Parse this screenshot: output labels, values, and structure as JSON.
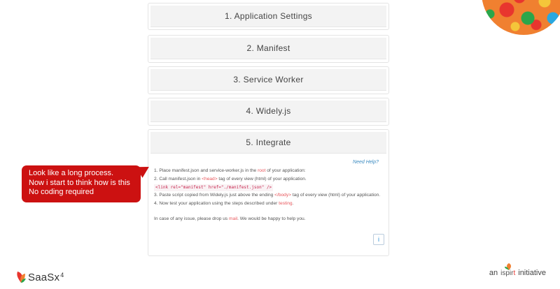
{
  "accordion": {
    "sections": [
      {
        "label": "1. Application Settings"
      },
      {
        "label": "2. Manifest"
      },
      {
        "label": "3. Service Worker"
      },
      {
        "label": "4. Widely.js"
      },
      {
        "label": "5. Integrate"
      }
    ],
    "integrate": {
      "need_help": "Need Help?",
      "step1_a": "1. Place manifest.json and service-worker.js in the ",
      "step1_root": "root",
      "step1_b": " of your application:",
      "step2_a": "2. Call manifest.json in ",
      "step2_head": "<head>",
      "step2_b": " tag of every view (html) of your application.",
      "code": "<link rel=\"manifest\" href=\"./manifest.json\" />",
      "step3_a": "3. Paste script copied from Widely.js just above the ending ",
      "step3_body": "</body>",
      "step3_b": " tag of every view (html) of your application.",
      "step4_a": "4. Now test your application using the steps described under ",
      "step4_link": "testing",
      "step4_b": ". ",
      "contact_a": "In case of any issue, please drop us ",
      "contact_link": "mail",
      "contact_b": ". We would be happy to help you.",
      "info_button": "i"
    }
  },
  "callout": {
    "line1": "Look like a long process.",
    "line2": "Now i start to think how is this",
    "line3": "No coding required"
  },
  "footer": {
    "saas_text": "SaaS",
    "saas_x": "x",
    "saas_sup": "4",
    "ispirt_prefix": "an",
    "ispirt_mark_a": "ispi",
    "ispirt_mark_r": "r",
    "ispirt_mark_t": "t",
    "ispirt_suffix": "initiative"
  },
  "colors": {
    "callout": "#cc1111",
    "link": "#e8565b",
    "help": "#3a8ac0"
  }
}
